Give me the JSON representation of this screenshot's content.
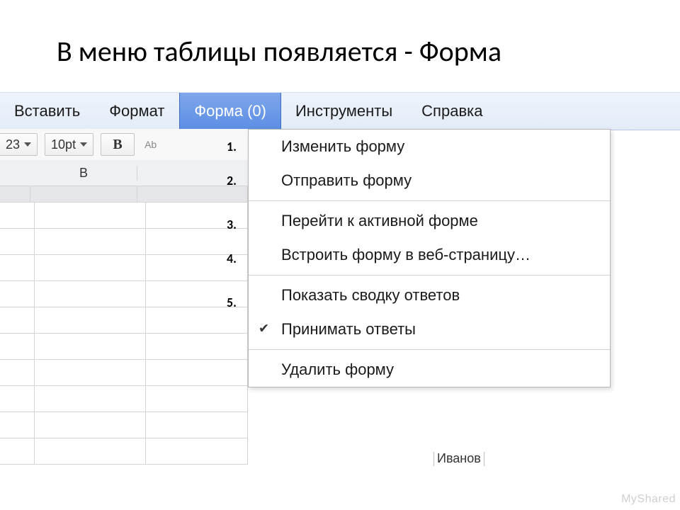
{
  "title": "В меню таблицы появляется - Форма",
  "menubar": {
    "items": [
      {
        "label": "Вставить",
        "active": false
      },
      {
        "label": "Формат",
        "active": false
      },
      {
        "label": "Форма (0)",
        "active": true
      },
      {
        "label": "Инструменты",
        "active": false
      },
      {
        "label": "Справка",
        "active": false
      }
    ]
  },
  "toolbar": {
    "numfmt_partial": "23",
    "fontsize": "10pt",
    "bold_glyph": "B",
    "strike_partial": "Ab"
  },
  "sheet": {
    "col_header_B": "B"
  },
  "dropdown": {
    "groups": [
      [
        {
          "label": "Изменить форму",
          "checked": false
        },
        {
          "label": "Отправить форму",
          "checked": false
        }
      ],
      [
        {
          "label": "Перейти к активной форме",
          "checked": false
        },
        {
          "label": "Встроить форму в веб-страницу…",
          "checked": false
        }
      ],
      [
        {
          "label": "Показать сводку ответов",
          "checked": false
        },
        {
          "label": "Принимать ответы",
          "checked": true
        }
      ],
      [
        {
          "label": "Удалить форму",
          "checked": false
        }
      ]
    ]
  },
  "annotations": [
    "1.",
    "2.",
    "3.",
    "4.",
    "5."
  ],
  "crop_fragment": "Иванов",
  "watermark": "MyShared"
}
